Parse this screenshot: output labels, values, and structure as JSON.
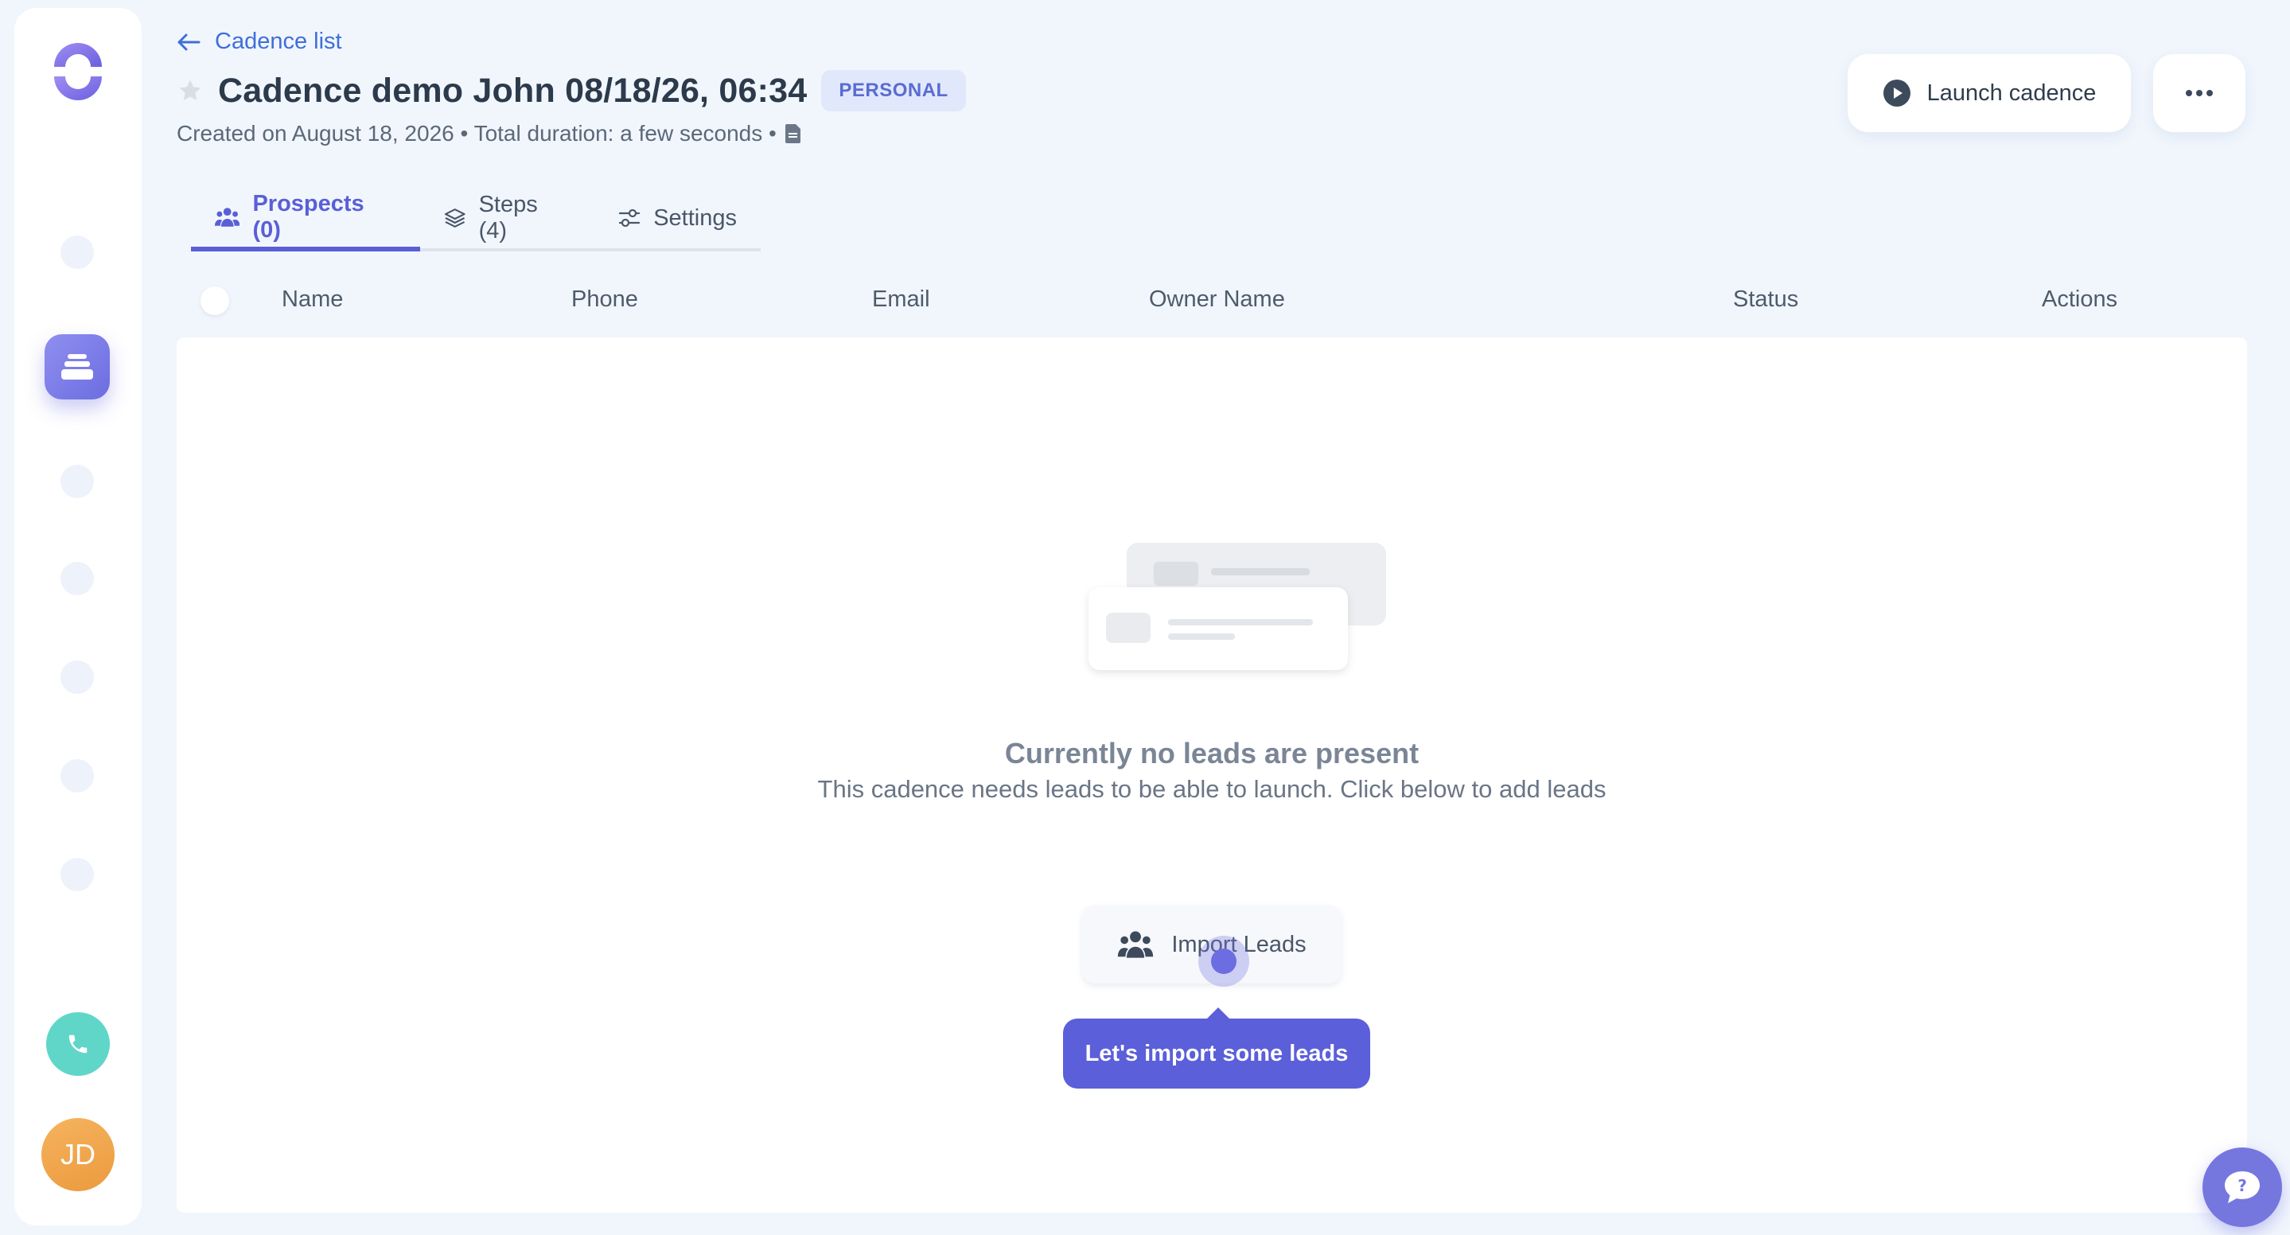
{
  "sidebar": {
    "avatar_initials": "JD",
    "active_icon": "cadence-stack-icon"
  },
  "header": {
    "back_label": "Cadence list",
    "title": "Cadence demo John 08/18/26, 06:34",
    "badge": "PERSONAL",
    "meta": "Created on August 18, 2026 • Total duration: a few seconds •",
    "launch_label": "Launch cadence"
  },
  "tabs": [
    {
      "label": "Prospects (0)",
      "icon": "people-icon",
      "active": true
    },
    {
      "label": "Steps (4)",
      "icon": "layers-icon",
      "active": false
    },
    {
      "label": "Settings",
      "icon": "sliders-icon",
      "active": false
    }
  ],
  "table": {
    "columns": [
      "Name",
      "Phone",
      "Email",
      "Owner Name",
      "Status",
      "Actions"
    ]
  },
  "empty_state": {
    "title": "Currently no leads are present",
    "subtitle": "This cadence needs leads to be able to launch. Click below to add leads",
    "import_label": "Import Leads",
    "tooltip": "Let's import some leads"
  },
  "colors": {
    "accent": "#5a5fd6",
    "background": "#f1f6fd",
    "link": "#3f6fd8",
    "phone": "#5fd6c8",
    "avatar": "#ec9a3e"
  }
}
